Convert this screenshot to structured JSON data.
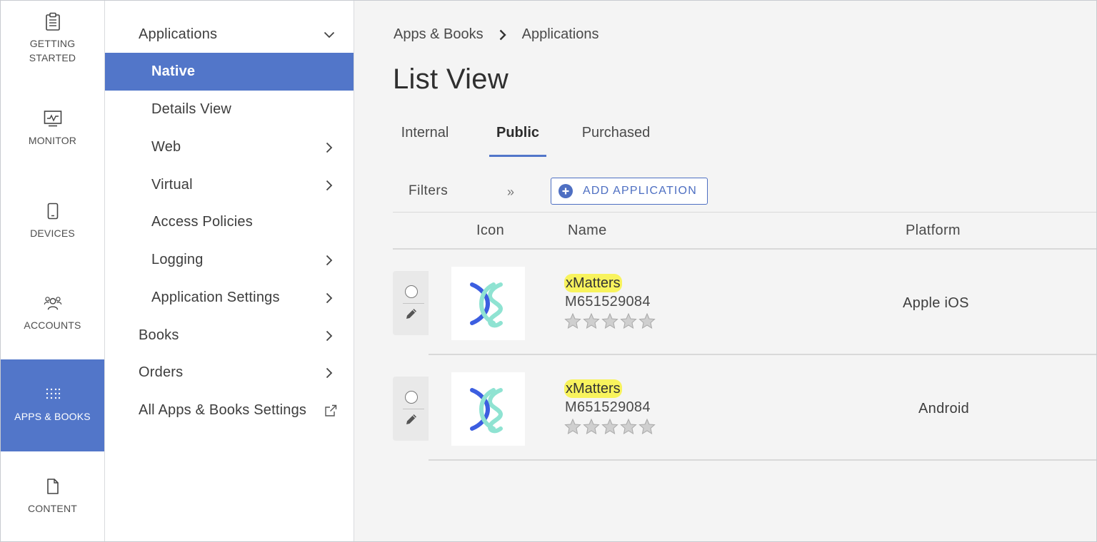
{
  "rail": {
    "items": [
      {
        "label": "GETTING\nSTARTED",
        "icon": "clipboard-icon"
      },
      {
        "label": "MONITOR",
        "icon": "monitor-icon"
      },
      {
        "label": "DEVICES",
        "icon": "phone-icon"
      },
      {
        "label": "ACCOUNTS",
        "icon": "people-icon"
      },
      {
        "label": "APPS & BOOKS",
        "icon": "apps-grid-icon",
        "active": true
      },
      {
        "label": "CONTENT",
        "icon": "document-icon"
      }
    ]
  },
  "subnav": {
    "items": [
      {
        "label": "Applications",
        "chevron": "down"
      },
      {
        "label": "Native",
        "active": true
      },
      {
        "label": "Details View"
      },
      {
        "label": "Web",
        "chevron": "right"
      },
      {
        "label": "Virtual",
        "chevron": "right"
      },
      {
        "label": "Access Policies"
      },
      {
        "label": "Logging",
        "chevron": "right"
      },
      {
        "label": "Application Settings",
        "chevron": "right"
      },
      {
        "label": "Books",
        "chevron": "right"
      },
      {
        "label": "Orders",
        "chevron": "right"
      },
      {
        "label": "All Apps & Books Settings",
        "external": true
      }
    ]
  },
  "breadcrumb": {
    "parent": "Apps & Books",
    "current": "Applications"
  },
  "page_title": "List View",
  "tabs": [
    {
      "label": "Internal"
    },
    {
      "label": "Public",
      "active": true
    },
    {
      "label": "Purchased"
    }
  ],
  "toolbar": {
    "filters_label": "Filters",
    "filters_toggle": "»",
    "add_label": "ADD APPLICATION"
  },
  "table": {
    "headers": {
      "icon": "Icon",
      "name": "Name",
      "platform": "Platform"
    },
    "rows": [
      {
        "name": "xMatters",
        "app_id": "M651529084",
        "rating": 0,
        "platform": "Apple iOS"
      },
      {
        "name": "xMatters",
        "app_id": "M651529084",
        "rating": 0,
        "platform": "Android"
      }
    ]
  },
  "colors": {
    "accent": "#5276c9",
    "highlight": "#f8f35d",
    "logo_blue": "#3c5ee0",
    "logo_teal": "#8fe3d2"
  }
}
